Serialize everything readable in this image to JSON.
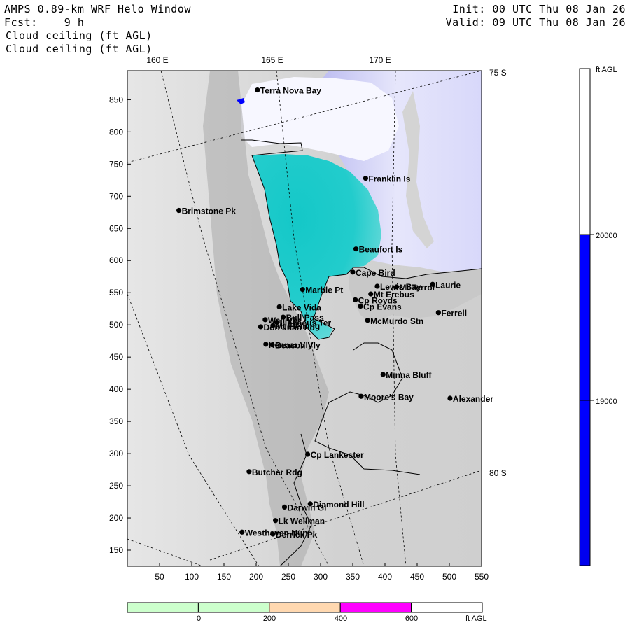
{
  "header": {
    "model": "AMPS 0.89-km WRF Helo Window",
    "fcst_label": "Fcst:",
    "fcst_value": "9 h",
    "init": "Init: 00 UTC Thu 08 Jan 26",
    "valid": "Valid: 09 UTC Thu 08 Jan 26",
    "field_1": "Cloud ceiling (ft AGL)",
    "field_2": "Cloud ceiling (ft AGL)"
  },
  "map": {
    "longitude_labels": [
      "160 E",
      "165 E",
      "170 E"
    ],
    "latitude_labels": [
      "75 S",
      "80 S"
    ],
    "x_ticks": [
      "50",
      "100",
      "150",
      "200",
      "250",
      "300",
      "350",
      "400",
      "450",
      "500",
      "550"
    ],
    "y_ticks": [
      "850",
      "800",
      "750",
      "700",
      "650",
      "600",
      "550",
      "500",
      "450",
      "400",
      "350",
      "300",
      "250",
      "200",
      "150"
    ],
    "stations": [
      {
        "name": "Terra Nova Bay",
        "x": 202,
        "y": 865
      },
      {
        "name": "Franklin Is",
        "x": 370,
        "y": 728
      },
      {
        "name": "Brimstone Pk",
        "x": 80,
        "y": 678
      },
      {
        "name": "Beaufort Is",
        "x": 355,
        "y": 618
      },
      {
        "name": "Cape Bird",
        "x": 350,
        "y": 582
      },
      {
        "name": "Lewis Bay",
        "x": 388,
        "y": 560
      },
      {
        "name": "Laurie",
        "x": 474,
        "y": 563
      },
      {
        "name": "Mt Terror",
        "x": 418,
        "y": 559
      },
      {
        "name": "Marble Pt",
        "x": 272,
        "y": 555
      },
      {
        "name": "Cp Royds",
        "x": 354,
        "y": 539
      },
      {
        "name": "Mt Erebus",
        "x": 378,
        "y": 548
      },
      {
        "name": "Cp Evans",
        "x": 362,
        "y": 529
      },
      {
        "name": "Ferrell",
        "x": 483,
        "y": 519
      },
      {
        "name": "Lake Vida",
        "x": 236,
        "y": 528
      },
      {
        "name": "Wall Vly",
        "x": 214,
        "y": 508
      },
      {
        "name": "Bull Pass",
        "x": 242,
        "y": 512
      },
      {
        "name": "McMurdo Stn",
        "x": 373,
        "y": 507
      },
      {
        "name": "Don Juan Pd",
        "x": 207,
        "y": 497
      },
      {
        "name": "Mt Fleming",
        "x": 226,
        "y": 499
      },
      {
        "name": "Linnaeus Ter",
        "x": 232,
        "y": 504
      },
      {
        "name": "Kennar Vly",
        "x": 215,
        "y": 470
      },
      {
        "name": "Beacon Vly",
        "x": 225,
        "y": 469
      },
      {
        "name": "Minna Bluff",
        "x": 397,
        "y": 423
      },
      {
        "name": "Moore's Bay",
        "x": 363,
        "y": 389
      },
      {
        "name": "Alexander",
        "x": 501,
        "y": 386
      },
      {
        "name": "Cp Lankester",
        "x": 280,
        "y": 299
      },
      {
        "name": "Butcher Rdg",
        "x": 189,
        "y": 272
      },
      {
        "name": "Darwin Gl",
        "x": 244,
        "y": 217
      },
      {
        "name": "Diamond Hill",
        "x": 284,
        "y": 222
      },
      {
        "name": "Lk Wellman",
        "x": 230,
        "y": 196
      },
      {
        "name": "Westhaven Nun",
        "x": 178,
        "y": 178
      },
      {
        "name": "Derrick Pk",
        "x": 226,
        "y": 175
      }
    ]
  },
  "colorbar_vertical": {
    "unit": "ft AGL",
    "ticks": [
      "20000",
      "19000"
    ]
  },
  "colorbar_horizontal": {
    "ticks": [
      "0",
      "200",
      "400",
      "600"
    ],
    "unit": "ft AGL",
    "colors": [
      "#ccffcc",
      "#ccffcc",
      "#ffd8b0",
      "#ff00ff",
      "#ffffff"
    ]
  },
  "palette": {
    "land": "#d9d9d9",
    "sea_cyan": "#1cc9c9",
    "lavender": "#d8d8fa",
    "ceiling_blue": "#0000ff"
  }
}
